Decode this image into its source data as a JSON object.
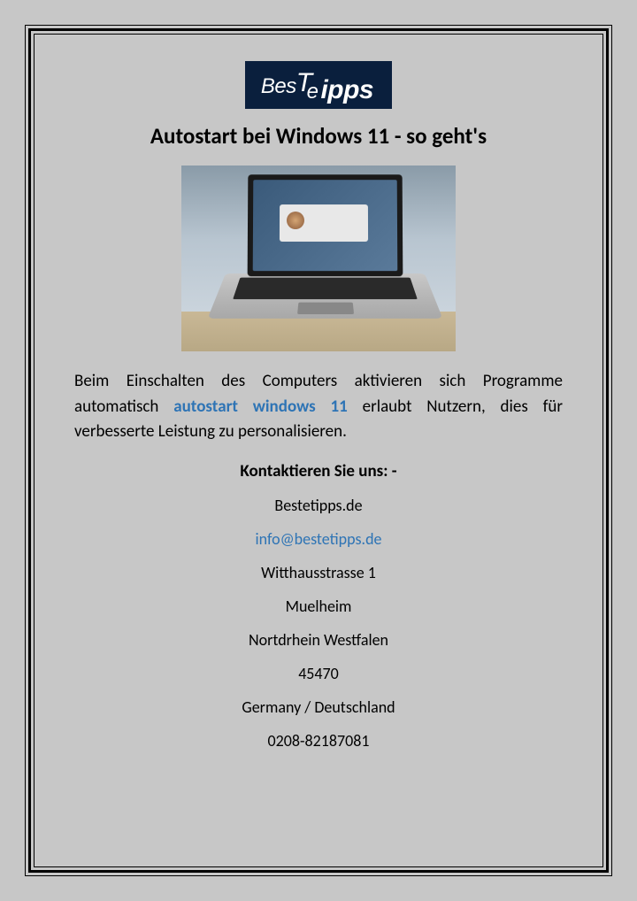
{
  "logo": {
    "part1": "Bes",
    "part2": "Tipps",
    "middle": "e"
  },
  "title": "Autostart bei Windows 11 - so geht's",
  "body": {
    "text_before": "Beim Einschalten des Computers aktivieren sich Programme automatisch ",
    "link_text": "autostart windows 11",
    "text_after": " erlaubt Nutzern, dies für verbesserte Leistung zu personalisieren."
  },
  "contact": {
    "heading": "Kontaktieren Sie uns: -",
    "website": "Bestetipps.de",
    "email": "info@bestetipps.de",
    "street": "Witthausstrasse 1",
    "city": "Muelheim",
    "state": "Nortdrhein Westfalen",
    "postal": "45470",
    "country": "Germany / Deutschland",
    "phone": "0208-82187081"
  }
}
